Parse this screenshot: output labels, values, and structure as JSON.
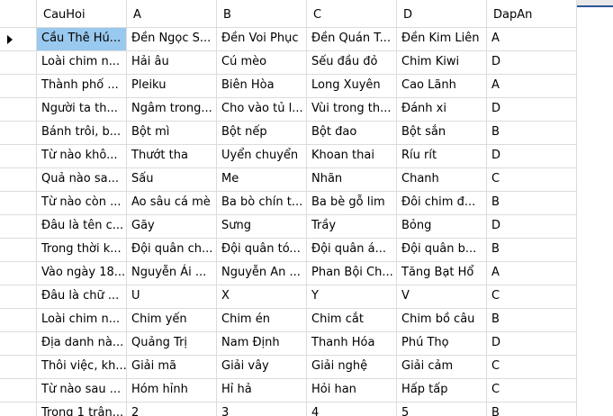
{
  "columns": [
    "CauHoi",
    "A",
    "B",
    "C",
    "D",
    "DapAn"
  ],
  "rows": [
    [
      "Cầu Thê Hú...",
      "Đền Ngọc S...",
      "Đền Voi Phục",
      "Đền Quán T...",
      "Đền Kim Liên",
      "A"
    ],
    [
      "Loài chim n...",
      "Hải âu",
      "Cú mèo",
      "Sếu đầu đỏ",
      "Chim Kiwi",
      "D"
    ],
    [
      "Thành phố ...",
      "Pleiku",
      "Biên Hòa",
      "Long Xuyên",
      "Cao Lãnh",
      "A"
    ],
    [
      "Người ta th...",
      "Ngâm trong...",
      "Cho vào tủ l...",
      "Vùi trong th...",
      "Đánh xi",
      "D"
    ],
    [
      "Bánh trôi, b...",
      "Bột mì",
      "Bột nếp",
      "Bột đao",
      "Bột sắn",
      "B"
    ],
    [
      "Từ nào khô...",
      "Thướt tha",
      "Uyển chuyển",
      "Khoan thai",
      "Ríu rít",
      "D"
    ],
    [
      "Quả nào sa...",
      "Sấu",
      "Me",
      "Nhãn",
      "Chanh",
      "C"
    ],
    [
      "Từ nào còn ...",
      "Ao sâu cá mè",
      "Ba bò chín t...",
      "Ba bè gỗ lim",
      "Đôi chim đ...",
      "B"
    ],
    [
      "Đâu là tên c...",
      "Gãy",
      "Sưng",
      "Trầy",
      "Bỏng",
      "D"
    ],
    [
      "Trong thời k...",
      "Đội quân ch...",
      "Đội quân tó...",
      "Đội quân á...",
      "Đội quân b...",
      "B"
    ],
    [
      "Vào ngày 18...",
      "Nguyễn Ái ...",
      "Nguyễn An ...",
      "Phan Bội Ch...",
      "Tăng Bạt Hổ",
      "A"
    ],
    [
      "Đâu là chữ ...",
      "U",
      "X",
      "Y",
      "V",
      "C"
    ],
    [
      "Loài chim n...",
      "Chim yến",
      "Chim én",
      "Chim cắt",
      "Chim bồ câu",
      "B"
    ],
    [
      "Địa danh nà...",
      "Quảng Trị",
      "Nam Định",
      "Thanh Hóa",
      "Phú Thọ",
      "D"
    ],
    [
      "Thôi việc, kh...",
      "Giải mã",
      "Giải vây",
      "Giải nghệ",
      "Giải cảm",
      "C"
    ],
    [
      "Từ nào sau ...",
      "Hóm hỉnh",
      "Hỉ hả",
      "Hỏi han",
      "Hấp tấp",
      "C"
    ],
    [
      "Trong 1 trận...",
      "2",
      "3",
      "4",
      "5",
      "B"
    ]
  ],
  "selected": {
    "row": 0,
    "col": 0
  }
}
